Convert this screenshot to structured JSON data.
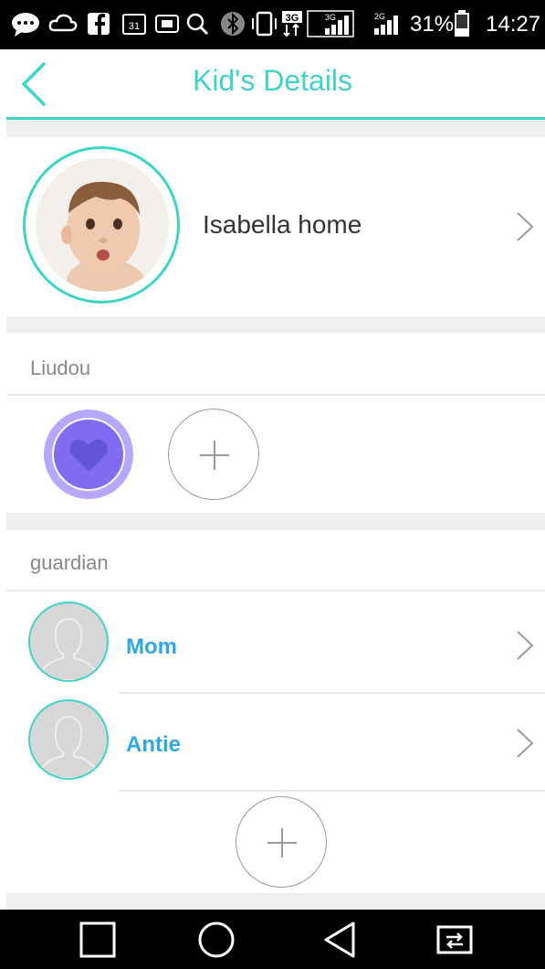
{
  "status_bar": {
    "battery": "31%",
    "time": "14:27",
    "net_3g": "3G",
    "net_2g": "2G",
    "cal_day": "31",
    "icons": [
      "messenger-icon",
      "cloud-icon",
      "facebook-icon",
      "calendar-icon",
      "sms-icon",
      "search-icon",
      "bluetooth-icon",
      "vibrate-icon",
      "data-transfer-icon",
      "signal-icon",
      "signal-icon",
      "battery-icon"
    ]
  },
  "header": {
    "title": "Kid's Details",
    "back_icon": "chevron-left-icon",
    "accent_color": "#3fd5c6"
  },
  "kid": {
    "name": "Isabella home",
    "avatar_icon": "baby-photo",
    "chevron_icon": "chevron-right-icon"
  },
  "devices": {
    "label": "Liudou",
    "device_icon": "heart-icon",
    "device_color": "#7f6cf2",
    "add_icon": "plus-icon"
  },
  "guardians": {
    "label": "guardian",
    "items": [
      {
        "name": "Mom"
      },
      {
        "name": "Antie"
      }
    ],
    "name_color": "#2fa7e6",
    "add_icon": "plus-icon"
  },
  "nav_bar": {
    "icons": [
      "square-icon",
      "circle-icon",
      "back-triangle-icon",
      "screen-switch-icon"
    ]
  }
}
